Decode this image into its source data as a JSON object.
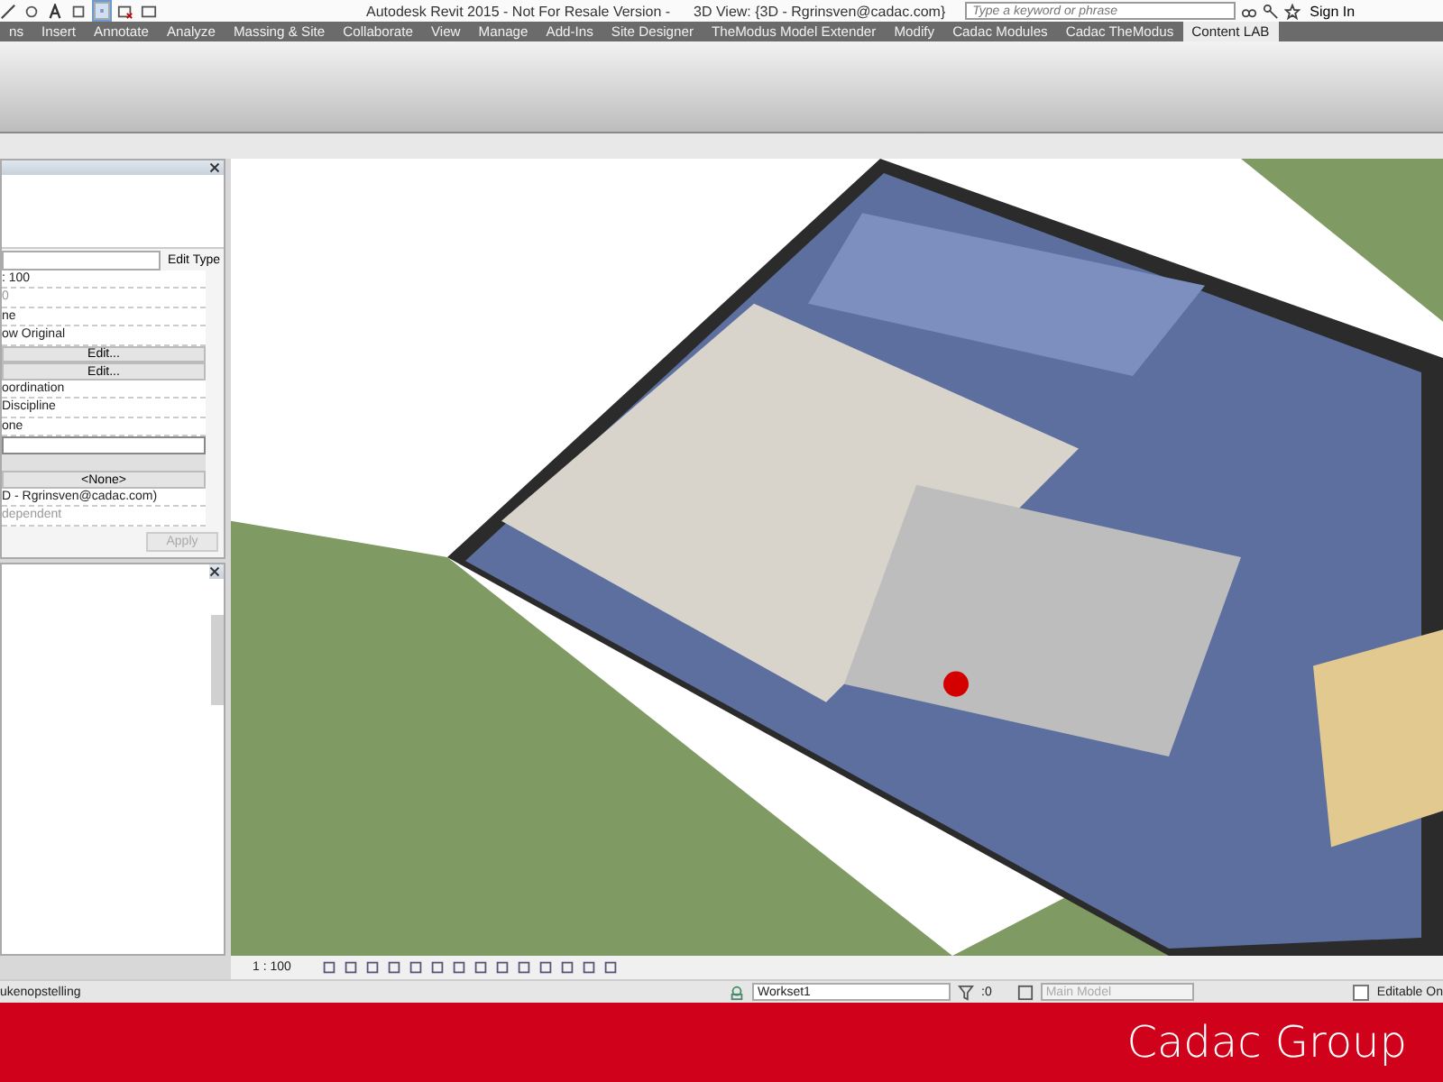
{
  "title_bar": {
    "title": "Autodesk Revit 2015 - Not For Resale Version -",
    "view_title": "3D View: {3D - Rgrinsven@cadac.com}",
    "search": {
      "placeholder": "Type a keyword or phrase"
    },
    "sign_in": "Sign In"
  },
  "ribbon": {
    "tabs": [
      {
        "label": "ns",
        "selected": false
      },
      {
        "label": "Insert",
        "selected": false
      },
      {
        "label": "Annotate",
        "selected": false
      },
      {
        "label": "Analyze",
        "selected": false
      },
      {
        "label": "Massing & Site",
        "selected": false
      },
      {
        "label": "Collaborate",
        "selected": false
      },
      {
        "label": "View",
        "selected": false
      },
      {
        "label": "Manage",
        "selected": false
      },
      {
        "label": "Add-Ins",
        "selected": false
      },
      {
        "label": "Site Designer",
        "selected": false
      },
      {
        "label": "TheModus Model Extender",
        "selected": false
      },
      {
        "label": "Modify",
        "selected": false
      },
      {
        "label": "Cadac Modules",
        "selected": false
      },
      {
        "label": "Cadac TheModus",
        "selected": false
      },
      {
        "label": "Content LAB",
        "selected": true
      }
    ]
  },
  "properties": {
    "edit_type": "Edit Type",
    "rows": [
      {
        "kind": "field",
        "value": ": 100",
        "disabled": false
      },
      {
        "kind": "field",
        "value": "0",
        "disabled": true
      },
      {
        "kind": "field",
        "value": "ne",
        "disabled": false
      },
      {
        "kind": "field",
        "value": "ow Original",
        "disabled": false
      },
      {
        "kind": "button",
        "value": "Edit..."
      },
      {
        "kind": "button",
        "value": "Edit..."
      },
      {
        "kind": "field",
        "value": "oordination",
        "disabled": false
      },
      {
        "kind": "field",
        "value": " Discipline",
        "disabled": false
      },
      {
        "kind": "field",
        "value": "one",
        "disabled": false
      },
      {
        "kind": "input"
      },
      {
        "kind": "header"
      },
      {
        "kind": "button",
        "value": "<None>"
      },
      {
        "kind": "field",
        "value": "D - Rgrinsven@cadac.com)",
        "disabled": false
      },
      {
        "kind": "field",
        "value": "dependent",
        "disabled": true
      }
    ],
    "apply": {
      "label": "Apply",
      "disabled": true
    }
  },
  "viewport": {
    "scale": "1 : 100"
  },
  "status_bar": {
    "message": "ukenopstelling",
    "workset": "Workset1",
    "count": ":0",
    "model": {
      "value": "Main Model",
      "disabled": true
    },
    "editable_only": {
      "label": "Editable On",
      "checked": false
    }
  },
  "footer": {
    "logo": "Cadac Group"
  }
}
